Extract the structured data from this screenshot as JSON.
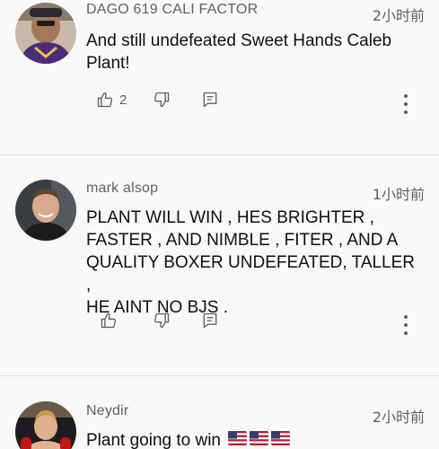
{
  "comments": [
    {
      "author": "DAGO 619 CALI FACTOR",
      "time": "2小时前",
      "text": "And still undefeated Sweet Hands Caleb\nPlant!",
      "like_count": "2"
    },
    {
      "author": "mark alsop",
      "time": "1小时前",
      "text": "PLANT  WILL WIN , HES BRIGHTER ,\nFASTER , AND  NIMBLE ,  FITER , AND A\nQUALITY BOXER UNDEFEATED,  TALLER  ,\nHE AINT NO BJS .",
      "like_count": ""
    },
    {
      "author": "Neydir",
      "time": "2小时前",
      "text": "Plant going to win",
      "like_count": ""
    }
  ],
  "icons": {
    "like": "thumb-up-icon",
    "dislike": "thumb-down-icon",
    "reply": "comment-reply-icon",
    "more": "more-vertical-icon",
    "flag": "us-flag-emoji"
  },
  "colors": {
    "background": "#f9f9f9",
    "secondary_text": "#606060",
    "divider": "#e0e0e0"
  }
}
